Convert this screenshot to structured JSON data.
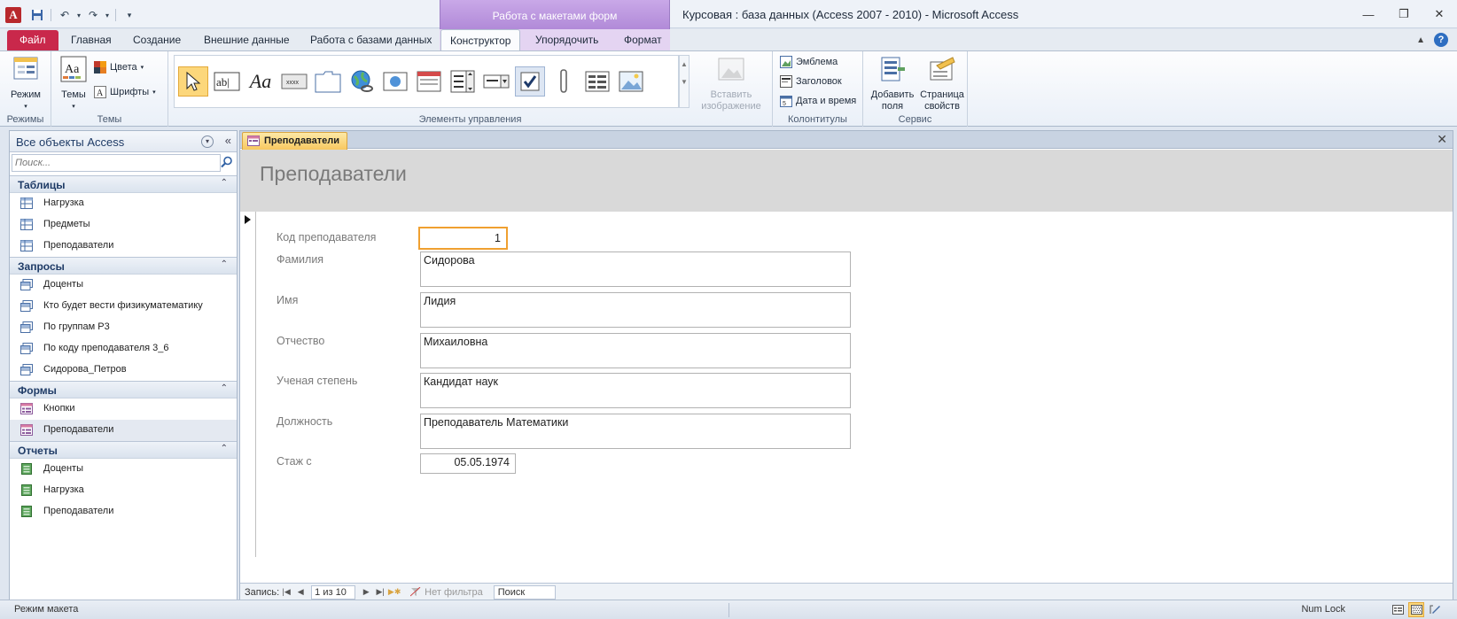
{
  "window": {
    "title": "Курсовая : база данных (Access 2007 - 2010)  -  Microsoft Access",
    "contextual_header": "Работа с макетами форм"
  },
  "tabs": [
    {
      "label": "Файл"
    },
    {
      "label": "Главная"
    },
    {
      "label": "Создание"
    },
    {
      "label": "Внешние данные"
    },
    {
      "label": "Работа с базами данных"
    },
    {
      "label": "Конструктор"
    },
    {
      "label": "Упорядочить"
    },
    {
      "label": "Формат"
    }
  ],
  "ribbon": {
    "views": {
      "button": "Режим",
      "group": "Режимы"
    },
    "themes": {
      "button": "Темы",
      "colors": "Цвета",
      "fonts": "Шрифты",
      "group": "Темы"
    },
    "controls": {
      "group": "Элементы управления",
      "insert_image_line1": "Вставить",
      "insert_image_line2": "изображение"
    },
    "header_footer": {
      "logo": "Эмблема",
      "title": "Заголовок",
      "datetime": "Дата и время",
      "group": "Колонтитулы"
    },
    "tools": {
      "add_fields_line1": "Добавить",
      "add_fields_line2": "поля",
      "property_sheet_line1": "Страница",
      "property_sheet_line2": "свойств",
      "group": "Сервис"
    }
  },
  "nav": {
    "title": "Все объекты Access",
    "search_placeholder": "Поиск...",
    "groups": [
      {
        "label": "Таблицы",
        "items": [
          "Нагрузка",
          "Предметы",
          "Преподаватели"
        ]
      },
      {
        "label": "Запросы",
        "items": [
          "Доценты",
          "Кто будет вести физикуматематику",
          "По группам Р3",
          "По коду преподавателя 3_6",
          "Сидорова_Петров"
        ]
      },
      {
        "label": "Формы",
        "items": [
          "Кнопки",
          "Преподаватели"
        ]
      },
      {
        "label": "Отчеты",
        "items": [
          "Доценты",
          "Нагрузка",
          "Преподаватели"
        ]
      }
    ]
  },
  "document": {
    "tab_label": "Преподаватели",
    "form_title": "Преподаватели",
    "fields": [
      {
        "label": "Код преподавателя",
        "value": "1"
      },
      {
        "label": "Фамилия",
        "value": "Сидорова"
      },
      {
        "label": "Имя",
        "value": "Лидия"
      },
      {
        "label": "Отчество",
        "value": "Михаиловна"
      },
      {
        "label": "Ученая степень",
        "value": "Кандидат наук"
      },
      {
        "label": "Должность",
        "value": "Преподаватель Математики"
      },
      {
        "label": "Стаж с",
        "value": "05.05.1974"
      }
    ]
  },
  "record_nav": {
    "label": "Запись:",
    "position": "1 из 10",
    "filter": "Нет фильтра",
    "search": "Поиск"
  },
  "status": {
    "mode": "Режим макета",
    "numlock": "Num Lock"
  },
  "colors": {
    "file_tab": "#c9284b",
    "contextual": "#b18ad8",
    "selection": "#fcd77b",
    "focus_border": "#f0a030"
  }
}
